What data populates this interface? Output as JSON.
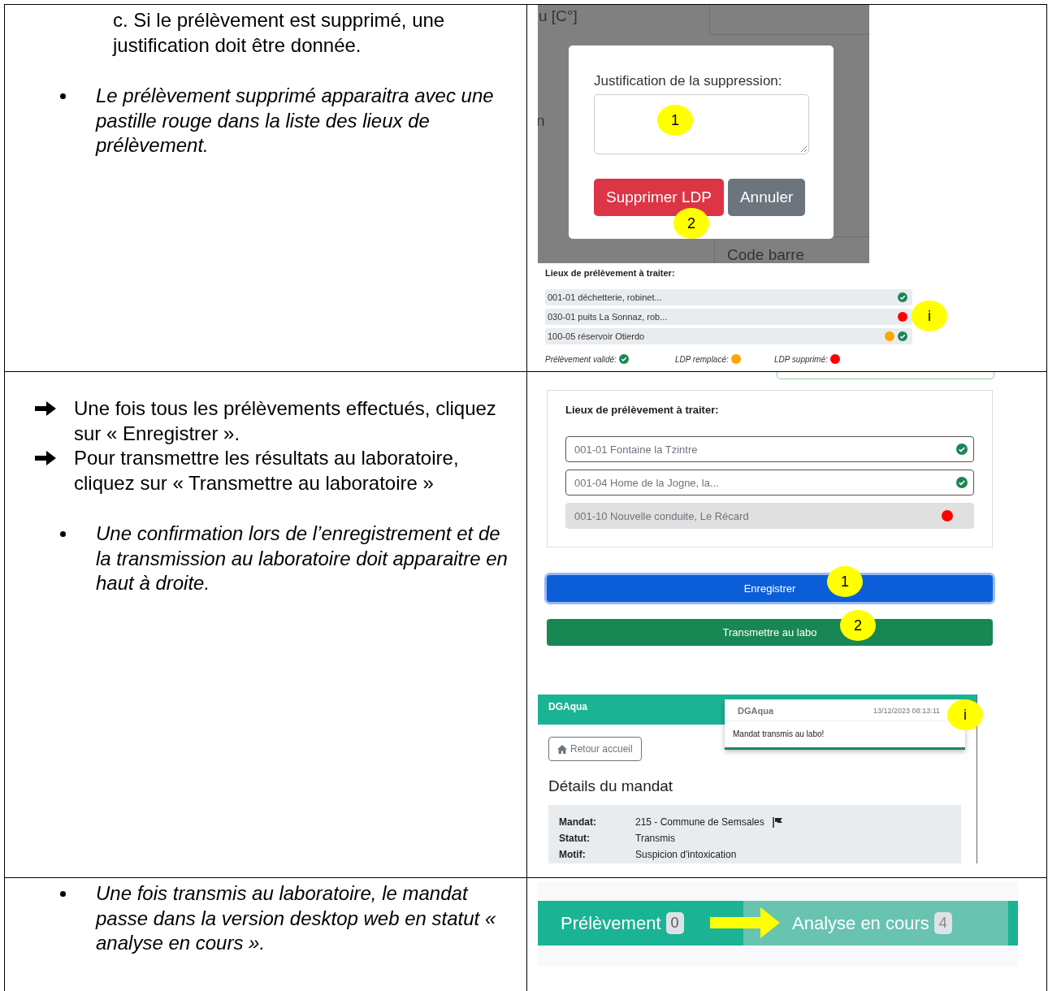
{
  "rows": [
    {
      "paragraphs": [
        {
          "kind": "indented",
          "text": "c. Si le prélèvement est supprimé, une justification doit être donnée."
        },
        {
          "kind": "bullet",
          "text": "Le prélèvement supprimé apparaitra avec une pastille rouge dans la liste des lieux de prélèvement."
        }
      ],
      "screenshot": {
        "kind": "delete-dialog",
        "background_texts": [
          "u [C°]",
          "n",
          "Code barre"
        ],
        "dialog": {
          "label": "Justification de la suppression:",
          "field_callout": "1",
          "buttons": [
            {
              "label": "Supprimer LDP",
              "kind": "danger",
              "callout": "2"
            },
            {
              "label": "Annuler",
              "kind": "secondary"
            }
          ]
        },
        "list_title": "Lieux de prélèvement à traiter:",
        "items": [
          {
            "label": "001-01 déchetterie, robinet...",
            "replaced": false,
            "deleted": false,
            "validated": true
          },
          {
            "label": "030-01 puits La Sonnaz, rob...",
            "replaced": false,
            "deleted": true,
            "validated": false,
            "callout": "i"
          },
          {
            "label": "100-05 réservoir Otierdo",
            "replaced": true,
            "deleted": false,
            "validated": true
          }
        ],
        "legend": [
          {
            "label": "Prélèvement validé:",
            "kind": "validated"
          },
          {
            "label": "LDP remplacé:",
            "kind": "replaced"
          },
          {
            "label": "LDP supprimé:",
            "kind": "deleted"
          }
        ]
      }
    },
    {
      "paragraphs": [
        {
          "kind": "arrow",
          "text": "Une fois tous les prélèvements effectués, cliquez sur « Enregistrer »."
        },
        {
          "kind": "arrow",
          "text": "Pour transmettre les résultats au laboratoire, cliquez sur « Transmettre au laboratoire »"
        },
        {
          "kind": "bullet",
          "text": "Une confirmation lors de l’enregistrement et de la transmission au laboratoire doit apparaitre en haut à droite."
        }
      ],
      "screenshot": {
        "kind": "save-transmit",
        "list_title": "Lieux de prélèvement à traiter:",
        "items": [
          {
            "label": "001-01 Fontaine la Tzintre",
            "replaced": false,
            "deleted": false,
            "validated": true,
            "disabled": false
          },
          {
            "label": "001-04 Home de la Jogne, la...",
            "replaced": false,
            "deleted": false,
            "validated": true,
            "disabled": false
          },
          {
            "label": "001-10 Nouvelle conduite, Le Récard",
            "replaced": false,
            "deleted": true,
            "validated": false,
            "disabled": true
          }
        ],
        "buttons": [
          {
            "label": "Enregistrer",
            "kind": "primary",
            "focused": true,
            "callout": "1"
          },
          {
            "label": "Transmettre au labo",
            "kind": "success",
            "focused": false,
            "callout": "2"
          }
        ],
        "app": {
          "brand": "DGAqua",
          "toast": {
            "title": "DGAqua",
            "time": "13/12/2023 08:13:11",
            "message": "Mandat transmis au labo!",
            "callout": "i"
          },
          "back_button": "Retour accueil",
          "heading": "Détails du mandat",
          "details": [
            {
              "label": "Mandat:",
              "value": "215 - Commune de Semsales",
              "flag": true
            },
            {
              "label": "Statut:",
              "value": "Transmis",
              "flag": false
            },
            {
              "label": "Motif:",
              "value": "Suspicion d'intoxication",
              "flag": false
            }
          ]
        }
      }
    },
    {
      "paragraphs": [
        {
          "kind": "bullet",
          "text": "Une fois transmis au laboratoire, le mandat passe dans la version desktop web en statut « analyse en cours »."
        }
      ],
      "screenshot": {
        "kind": "status-tabs",
        "tabs": [
          {
            "label": "Prélèvement",
            "count": "0",
            "selected": true
          },
          {
            "label": "Analyse en cours",
            "count": "4",
            "selected": false
          }
        ]
      }
    }
  ]
}
